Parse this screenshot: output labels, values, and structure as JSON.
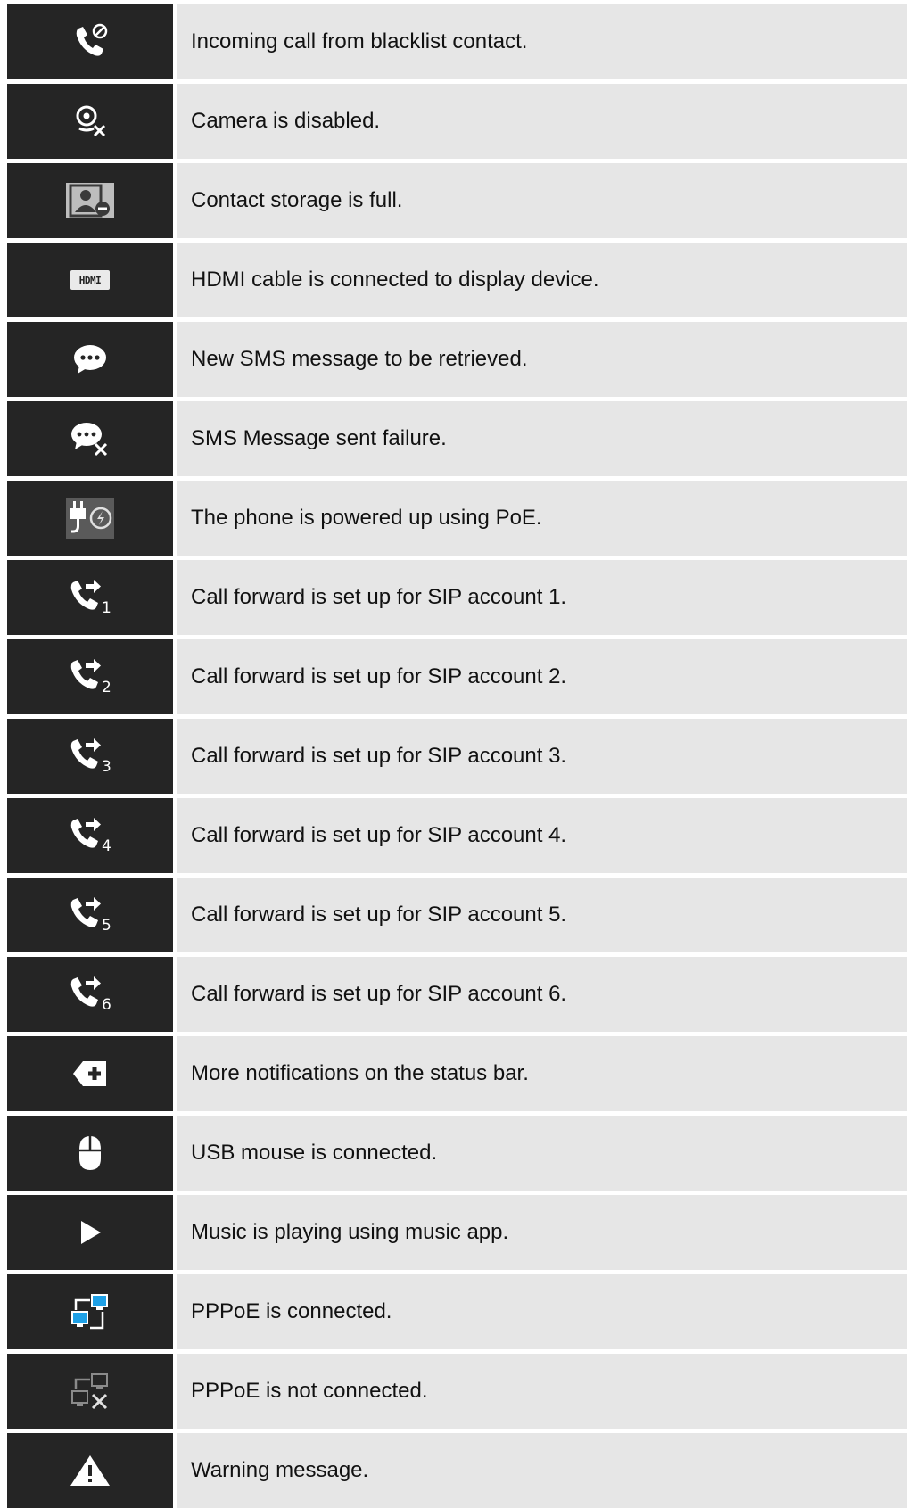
{
  "colors": {
    "icon_bg": "#252525",
    "desc_bg": "#e6e6e6",
    "icon_fg": "#ffffff",
    "pppoe_blue": "#1ea0e6"
  },
  "rows": [
    {
      "icon": "blacklist-call-icon",
      "text": "Incoming call from blacklist contact."
    },
    {
      "icon": "camera-disabled-icon",
      "text": "Camera is disabled."
    },
    {
      "icon": "contact-storage-full-icon",
      "text": "Contact storage is full."
    },
    {
      "icon": "hdmi-icon",
      "icon_label": "HDMI",
      "text": "HDMI cable is connected to display device."
    },
    {
      "icon": "sms-message-icon",
      "text": "New SMS message to be retrieved."
    },
    {
      "icon": "sms-failure-icon",
      "text": "SMS Message sent failure."
    },
    {
      "icon": "poe-power-icon",
      "text": "The phone is powered up using PoE."
    },
    {
      "icon": "call-forward-icon",
      "icon_label": "1",
      "text": "Call forward is set up for SIP account 1."
    },
    {
      "icon": "call-forward-icon",
      "icon_label": "2",
      "text": "Call forward is set up for SIP account 2."
    },
    {
      "icon": "call-forward-icon",
      "icon_label": "3",
      "text": "Call forward is set up for SIP account 3."
    },
    {
      "icon": "call-forward-icon",
      "icon_label": "4",
      "text": "Call forward is set up for SIP account 4."
    },
    {
      "icon": "call-forward-icon",
      "icon_label": "5",
      "text": "Call forward is set up for SIP account 5."
    },
    {
      "icon": "call-forward-icon",
      "icon_label": "6",
      "text": "Call forward is set up for SIP account 6."
    },
    {
      "icon": "more-notifications-icon",
      "text": "More notifications on the status bar."
    },
    {
      "icon": "usb-mouse-icon",
      "text": "USB mouse is connected."
    },
    {
      "icon": "music-playing-icon",
      "text": "Music is playing using music app."
    },
    {
      "icon": "pppoe-connected-icon",
      "text": "PPPoE is connected."
    },
    {
      "icon": "pppoe-disconnected-icon",
      "text": "PPPoE is not connected."
    },
    {
      "icon": "warning-icon",
      "text": "Warning message."
    }
  ]
}
